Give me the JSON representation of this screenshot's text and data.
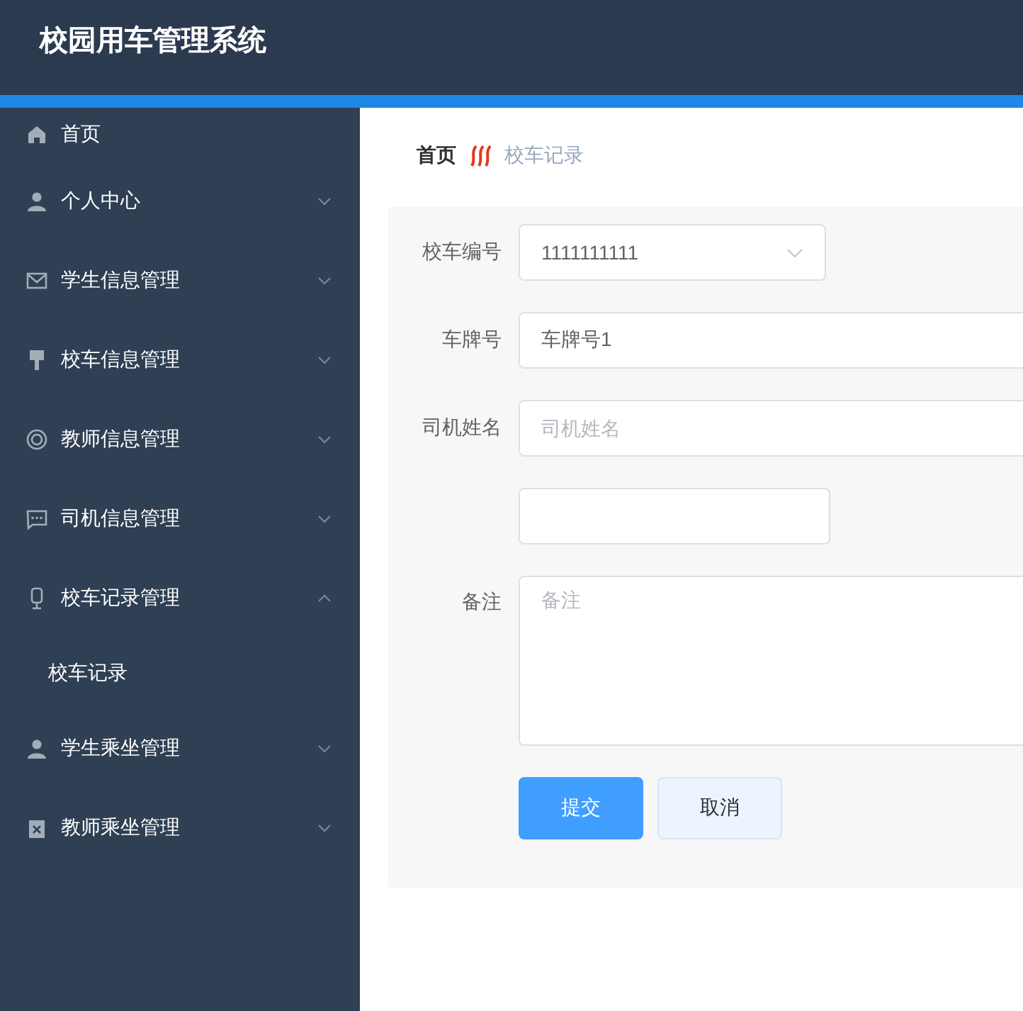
{
  "header": {
    "title": "校园用车管理系统"
  },
  "sidebar": {
    "items": [
      {
        "label": "首页",
        "kind": "link"
      },
      {
        "label": "个人中心",
        "kind": "submenu",
        "expanded": false
      },
      {
        "label": "学生信息管理",
        "kind": "submenu",
        "expanded": false
      },
      {
        "label": "校车信息管理",
        "kind": "submenu",
        "expanded": false
      },
      {
        "label": "教师信息管理",
        "kind": "submenu",
        "expanded": false
      },
      {
        "label": "司机信息管理",
        "kind": "submenu",
        "expanded": false
      },
      {
        "label": "校车记录管理",
        "kind": "submenu",
        "expanded": true,
        "children": [
          {
            "label": "校车记录"
          }
        ]
      },
      {
        "label": "学生乘坐管理",
        "kind": "submenu",
        "expanded": false
      },
      {
        "label": "教师乘坐管理",
        "kind": "submenu",
        "expanded": false
      }
    ]
  },
  "breadcrumb": [
    "首页",
    "校车记录"
  ],
  "form": {
    "fields": [
      {
        "label": "校车编号",
        "kind": "select",
        "value": "1111111111"
      },
      {
        "label": "车牌号",
        "kind": "input",
        "value": "车牌号1"
      },
      {
        "label": "司机姓名",
        "kind": "input",
        "placeholder": "司机姓名"
      },
      {
        "kind": "short-input"
      },
      {
        "label": "备注",
        "kind": "textarea",
        "placeholder": "备注"
      }
    ],
    "buttons": [
      {
        "label": "提交",
        "kind": "primary"
      },
      {
        "label": "取消",
        "kind": "plain"
      }
    ]
  }
}
